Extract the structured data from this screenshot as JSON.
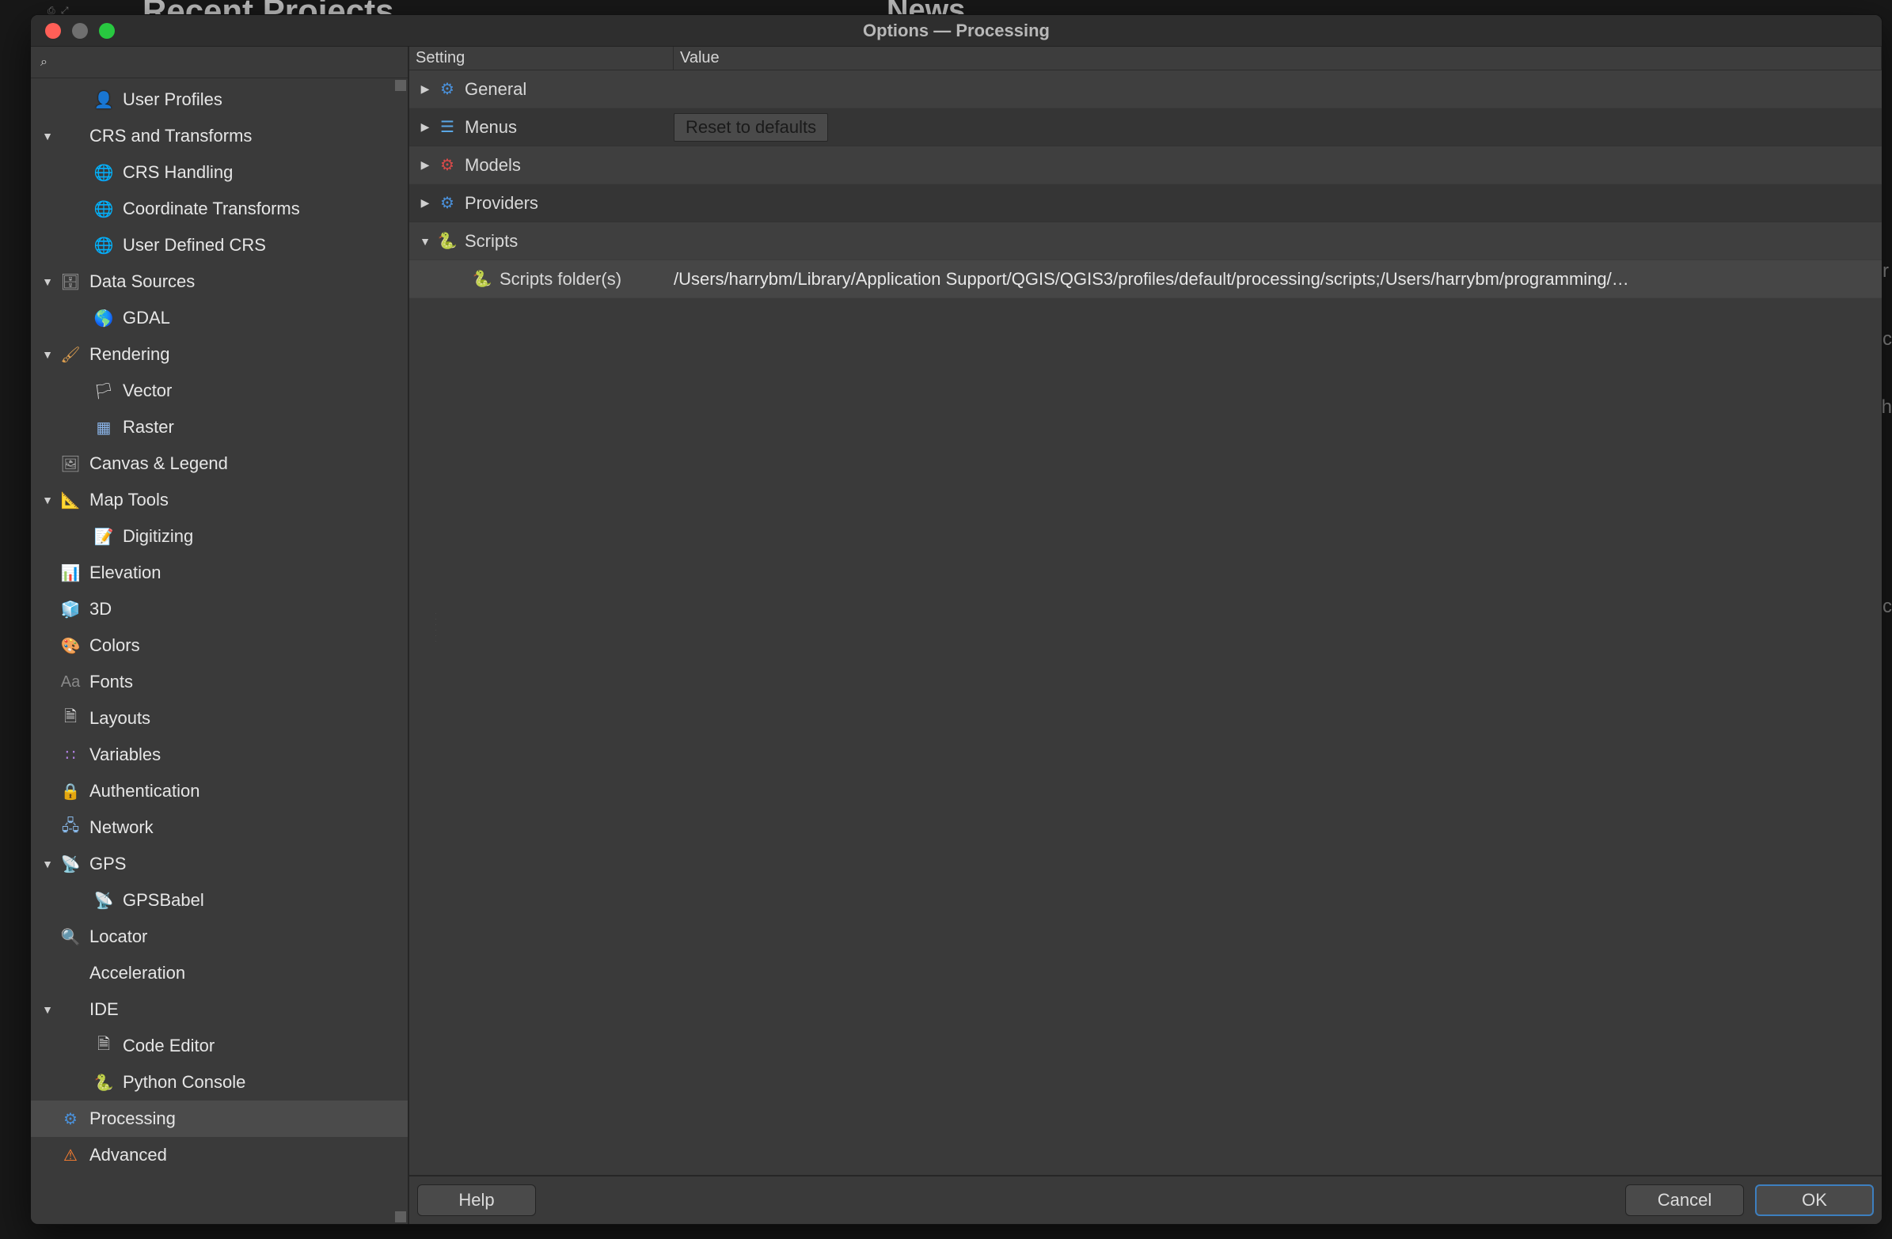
{
  "backdrop": {
    "left_title": "Recent Projects",
    "right_title": "News"
  },
  "dialog": {
    "title": "Options — Processing"
  },
  "search": {
    "placeholder": ""
  },
  "sidebar": [
    {
      "id": "user-profiles",
      "label": "User Profiles",
      "level": 1,
      "disc": "none",
      "icon": "👤",
      "icls": "ic-user"
    },
    {
      "id": "crs-transforms",
      "label": "CRS and Transforms",
      "level": 0,
      "disc": "open",
      "icon": "",
      "icls": ""
    },
    {
      "id": "crs-handling",
      "label": "CRS Handling",
      "level": 1,
      "disc": "none",
      "icon": "🌐",
      "icls": "ic-globe"
    },
    {
      "id": "coord-transforms",
      "label": "Coordinate Transforms",
      "level": 1,
      "disc": "none",
      "icon": "🌐",
      "icls": "ic-globe"
    },
    {
      "id": "user-defined-crs",
      "label": "User Defined CRS",
      "level": 1,
      "disc": "none",
      "icon": "🌐",
      "icls": "ic-globe"
    },
    {
      "id": "data-sources",
      "label": "Data Sources",
      "level": 0,
      "disc": "open",
      "icon": "🗄",
      "icls": "ic-canvas"
    },
    {
      "id": "gdal",
      "label": "GDAL",
      "level": 1,
      "disc": "none",
      "icon": "🌎",
      "icls": "ic-globe"
    },
    {
      "id": "rendering",
      "label": "Rendering",
      "level": 0,
      "disc": "open",
      "icon": "🖌",
      "icls": "ic-brush"
    },
    {
      "id": "vector",
      "label": "Vector",
      "level": 1,
      "disc": "none",
      "icon": "🏳",
      "icls": "ic-flag"
    },
    {
      "id": "raster",
      "label": "Raster",
      "level": 1,
      "disc": "none",
      "icon": "▦",
      "icls": "ic-raster"
    },
    {
      "id": "canvas-legend",
      "label": "Canvas & Legend",
      "level": 0,
      "disc": "leaf",
      "icon": "🖼",
      "icls": "ic-canvas"
    },
    {
      "id": "map-tools",
      "label": "Map Tools",
      "level": 0,
      "disc": "open",
      "icon": "📐",
      "icls": "ic-maptool"
    },
    {
      "id": "digitizing",
      "label": "Digitizing",
      "level": 1,
      "disc": "none",
      "icon": "📝",
      "icls": "ic-dig"
    },
    {
      "id": "elevation",
      "label": "Elevation",
      "level": 0,
      "disc": "leaf",
      "icon": "📊",
      "icls": "ic-elev"
    },
    {
      "id": "3d",
      "label": "3D",
      "level": 0,
      "disc": "leaf",
      "icon": "🧊",
      "icls": "ic-cube"
    },
    {
      "id": "colors",
      "label": "Colors",
      "level": 0,
      "disc": "leaf",
      "icon": "🎨",
      "icls": "ic-colors"
    },
    {
      "id": "fonts",
      "label": "Fonts",
      "level": 0,
      "disc": "leaf",
      "icon": "Aa",
      "icls": "ic-fonts"
    },
    {
      "id": "layouts",
      "label": "Layouts",
      "level": 0,
      "disc": "leaf",
      "icon": "🗎",
      "icls": "ic-layout"
    },
    {
      "id": "variables",
      "label": "Variables",
      "level": 0,
      "disc": "leaf",
      "icon": "∷",
      "icls": "ic-var"
    },
    {
      "id": "authentication",
      "label": "Authentication",
      "level": 0,
      "disc": "leaf",
      "icon": "🔒",
      "icls": "ic-lock"
    },
    {
      "id": "network",
      "label": "Network",
      "level": 0,
      "disc": "leaf",
      "icon": "🖧",
      "icls": "ic-net"
    },
    {
      "id": "gps",
      "label": "GPS",
      "level": 0,
      "disc": "open",
      "icon": "📡",
      "icls": "ic-gps"
    },
    {
      "id": "gpsbabel",
      "label": "GPSBabel",
      "level": 1,
      "disc": "none",
      "icon": "📡",
      "icls": "ic-gps"
    },
    {
      "id": "locator",
      "label": "Locator",
      "level": 0,
      "disc": "leaf",
      "icon": "🔍",
      "icls": "ic-search"
    },
    {
      "id": "acceleration",
      "label": "Acceleration",
      "level": 0,
      "disc": "leaf",
      "icon": "",
      "icls": ""
    },
    {
      "id": "ide",
      "label": "IDE",
      "level": 0,
      "disc": "open",
      "icon": "",
      "icls": ""
    },
    {
      "id": "code-editor",
      "label": "Code Editor",
      "level": 1,
      "disc": "none",
      "icon": "🗎",
      "icls": "ic-file"
    },
    {
      "id": "python-console",
      "label": "Python Console",
      "level": 1,
      "disc": "none",
      "icon": "🐍",
      "icls": "ic-python"
    },
    {
      "id": "processing",
      "label": "Processing",
      "level": 0,
      "disc": "leaf",
      "icon": "⚙",
      "icls": "ic-gear",
      "selected": true
    },
    {
      "id": "advanced",
      "label": "Advanced",
      "level": 0,
      "disc": "leaf",
      "icon": "⚠",
      "icls": "ic-adv"
    }
  ],
  "columns": {
    "setting": "Setting",
    "value": "Value"
  },
  "settings": [
    {
      "id": "general",
      "label": "General",
      "disc": "closed",
      "icon": "⚙",
      "icls": "ic-gear",
      "value": "",
      "level": 0,
      "row": "alt"
    },
    {
      "id": "menus",
      "label": "Menus",
      "disc": "closed",
      "icon": "☰",
      "icls": "ic-menu",
      "value_button": "Reset to defaults",
      "level": 0,
      "row": "dark"
    },
    {
      "id": "models",
      "label": "Models",
      "disc": "closed",
      "icon": "⚙",
      "icls": "ic-gear-red",
      "value": "",
      "level": 0,
      "row": "alt"
    },
    {
      "id": "providers",
      "label": "Providers",
      "disc": "closed",
      "icon": "⚙",
      "icls": "ic-gear",
      "value": "",
      "level": 0,
      "row": "dark"
    },
    {
      "id": "scripts",
      "label": "Scripts",
      "disc": "open",
      "icon": "🐍",
      "icls": "ic-python",
      "value": "",
      "level": 0,
      "row": "alt"
    },
    {
      "id": "scripts-folders",
      "label": "Scripts folder(s)",
      "disc": "none",
      "icon": "🐍",
      "icls": "ic-python",
      "value": "/Users/harrybm/Library/Application Support/QGIS/QGIS3/profiles/default/processing/scripts;/Users/harrybm/programming/…",
      "level": 1,
      "row": "leaf"
    }
  ],
  "buttons": {
    "help": "Help",
    "cancel": "Cancel",
    "ok": "OK",
    "reset": "Reset to defaults"
  }
}
